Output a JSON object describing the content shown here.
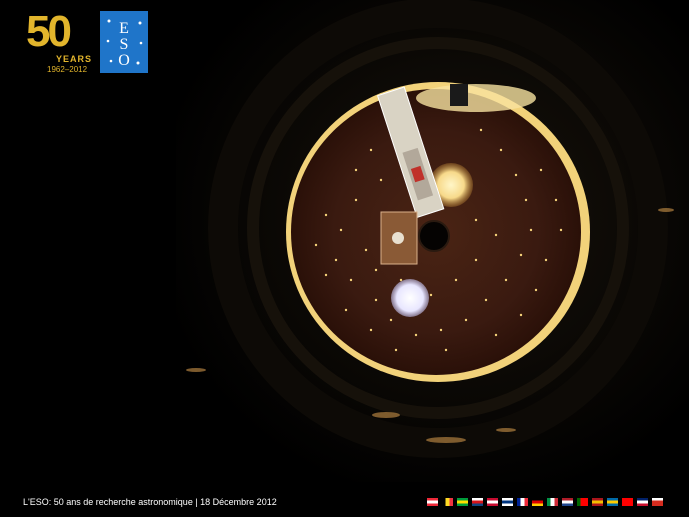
{
  "logo": {
    "anniversary": "50",
    "years_label": "YEARS",
    "range": "1962–2012",
    "eso_letters": [
      "E",
      "S",
      "O"
    ]
  },
  "footer": {
    "caption": "L'ESO: 50 ans de recherche  astronomique | 18 Décembre 2012"
  },
  "colors": {
    "gold": "#e2b52c",
    "eso_blue": "#1f75c9",
    "dome_inner": "#3a1a10",
    "rim_light": "#f2d27a"
  },
  "flags": [
    {
      "name": "austria-flag",
      "colors": [
        "#ed2939",
        "#ffffff",
        "#ed2939"
      ],
      "orient": "h"
    },
    {
      "name": "belgium-flag",
      "colors": [
        "#000000",
        "#fdda24",
        "#ef3340"
      ],
      "orient": "v"
    },
    {
      "name": "brazil-flag",
      "colors": [
        "#009c3b",
        "#ffdf00",
        "#009c3b"
      ],
      "orient": "h"
    },
    {
      "name": "czech-flag",
      "colors": [
        "#ffffff",
        "#d7141a",
        "#11457e"
      ],
      "orient": "h"
    },
    {
      "name": "denmark-flag",
      "colors": [
        "#c60c30",
        "#ffffff",
        "#c60c30"
      ],
      "orient": "h"
    },
    {
      "name": "finland-flag",
      "colors": [
        "#ffffff",
        "#003580",
        "#ffffff"
      ],
      "orient": "h"
    },
    {
      "name": "france-flag",
      "colors": [
        "#002395",
        "#ffffff",
        "#ed2939"
      ],
      "orient": "v"
    },
    {
      "name": "germany-flag",
      "colors": [
        "#000000",
        "#dd0000",
        "#ffce00"
      ],
      "orient": "h"
    },
    {
      "name": "italy-flag",
      "colors": [
        "#009246",
        "#ffffff",
        "#ce2b37"
      ],
      "orient": "v"
    },
    {
      "name": "netherlands-flag",
      "colors": [
        "#ae1c28",
        "#ffffff",
        "#21468b"
      ],
      "orient": "h"
    },
    {
      "name": "portugal-flag",
      "colors": [
        "#006600",
        "#ff0000",
        "#ff0000"
      ],
      "orient": "v"
    },
    {
      "name": "spain-flag",
      "colors": [
        "#aa151b",
        "#f1bf00",
        "#aa151b"
      ],
      "orient": "h"
    },
    {
      "name": "sweden-flag",
      "colors": [
        "#006aa7",
        "#fecc00",
        "#006aa7"
      ],
      "orient": "h"
    },
    {
      "name": "switzerland-flag",
      "colors": [
        "#ff0000",
        "#ff0000",
        "#ff0000"
      ],
      "orient": "h"
    },
    {
      "name": "uk-flag",
      "colors": [
        "#012169",
        "#ffffff",
        "#c8102e"
      ],
      "orient": "h"
    },
    {
      "name": "chile-flag",
      "colors": [
        "#ffffff",
        "#d52b1e",
        "#d52b1e"
      ],
      "orient": "h"
    }
  ]
}
